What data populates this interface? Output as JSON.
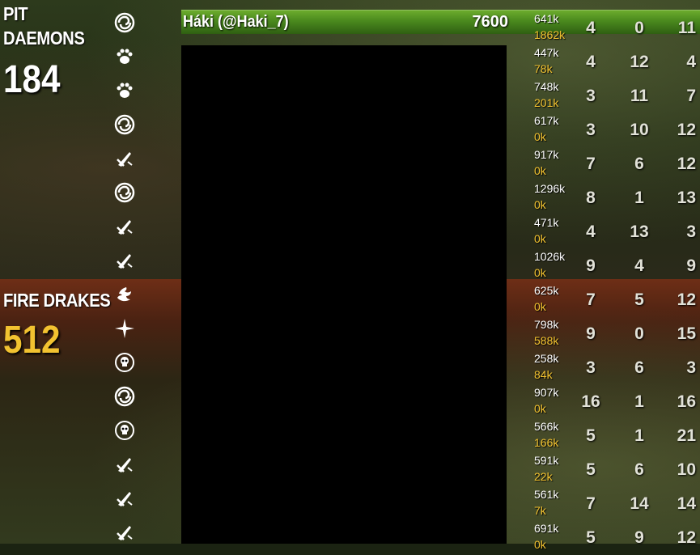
{
  "teams": [
    {
      "name_line1": "PIT",
      "name_line2": "DAEMONS",
      "score": "184",
      "score_color": "#ffffff"
    },
    {
      "name_line1": "FIRE DRAKES",
      "score": "512",
      "score_color": "#f2c230"
    }
  ],
  "highlight": {
    "player": "Háki (@Haki_7)",
    "score": "7600"
  },
  "rows": [
    {
      "icon": "swirl-icon",
      "dmg": "641k",
      "heal": "1862k",
      "kills": "4",
      "deaths": "0",
      "assists": "11"
    },
    {
      "icon": "paw-icon",
      "dmg": "447k",
      "heal": "78k",
      "kills": "4",
      "deaths": "12",
      "assists": "4"
    },
    {
      "icon": "paw-icon",
      "dmg": "748k",
      "heal": "201k",
      "kills": "3",
      "deaths": "11",
      "assists": "7"
    },
    {
      "icon": "swirl-icon",
      "dmg": "617k",
      "heal": "0k",
      "kills": "3",
      "deaths": "10",
      "assists": "12"
    },
    {
      "icon": "blade-icon",
      "dmg": "917k",
      "heal": "0k",
      "kills": "7",
      "deaths": "6",
      "assists": "12"
    },
    {
      "icon": "swirl-icon",
      "dmg": "1296k",
      "heal": "0k",
      "kills": "8",
      "deaths": "1",
      "assists": "13"
    },
    {
      "icon": "blade-icon",
      "dmg": "471k",
      "heal": "0k",
      "kills": "4",
      "deaths": "13",
      "assists": "3"
    },
    {
      "icon": "blade-icon",
      "dmg": "1026k",
      "heal": "0k",
      "kills": "9",
      "deaths": "4",
      "assists": "9"
    },
    {
      "icon": "dragon-icon",
      "dmg": "625k",
      "heal": "0k",
      "kills": "7",
      "deaths": "5",
      "assists": "12"
    },
    {
      "icon": "star-burst-icon",
      "dmg": "798k",
      "heal": "588k",
      "kills": "9",
      "deaths": "0",
      "assists": "15"
    },
    {
      "icon": "skull-icon",
      "dmg": "258k",
      "heal": "84k",
      "kills": "3",
      "deaths": "6",
      "assists": "3"
    },
    {
      "icon": "swirl-icon",
      "dmg": "907k",
      "heal": "0k",
      "kills": "16",
      "deaths": "1",
      "assists": "16"
    },
    {
      "icon": "skull-icon",
      "dmg": "566k",
      "heal": "166k",
      "kills": "5",
      "deaths": "1",
      "assists": "21"
    },
    {
      "icon": "blade-icon",
      "dmg": "591k",
      "heal": "22k",
      "kills": "5",
      "deaths": "6",
      "assists": "10"
    },
    {
      "icon": "blade-icon",
      "dmg": "561k",
      "heal": "7k",
      "kills": "7",
      "deaths": "14",
      "assists": "14"
    },
    {
      "icon": "blade-icon",
      "dmg": "691k",
      "heal": "0k",
      "kills": "5",
      "deaths": "9",
      "assists": "12"
    }
  ]
}
